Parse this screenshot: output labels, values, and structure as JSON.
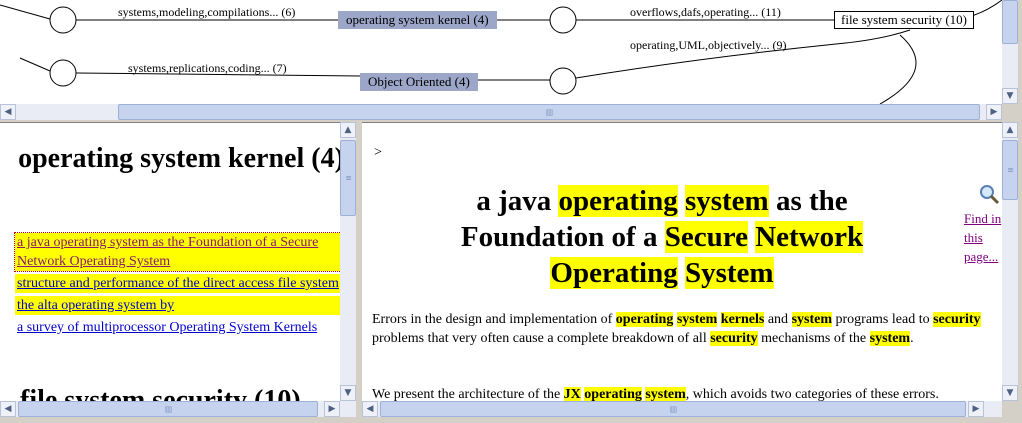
{
  "graph": {
    "edges": [
      {
        "label": "systems,modeling,compilations... (6)"
      },
      {
        "label": "overflows,dafs,operating... (11)"
      },
      {
        "label": "operating,UML,objectively... (9)"
      },
      {
        "label": "systems,replications,coding... (7)"
      }
    ],
    "topics": [
      {
        "label": "operating system kernel (4)"
      },
      {
        "label": "Object Oriented (4)"
      }
    ],
    "selected": {
      "label": "file system security (10)"
    }
  },
  "left": {
    "heading1": "operating system kernel (4)",
    "links": [
      {
        "text": "a java operating system as the Foundation of a Secure Network Operating System",
        "highlight": true
      },
      {
        "text": "structure and performance of the direct access file system",
        "highlight": true
      },
      {
        "text": "the alta operating system by",
        "highlight": true
      },
      {
        "text": "a survey of multiprocessor Operating System Kernels",
        "highlight": false
      }
    ],
    "heading2": "file system security (10)"
  },
  "right": {
    "prompt": ">",
    "title_parts": [
      {
        "t": "a java ",
        "h": false
      },
      {
        "t": "operating",
        "h": true
      },
      {
        "t": " ",
        "h": false
      },
      {
        "t": "system",
        "h": true
      },
      {
        "t": " as the Foundation of a ",
        "h": false
      },
      {
        "t": "Secure",
        "h": true
      },
      {
        "t": " ",
        "h": false
      },
      {
        "t": "Network",
        "h": true
      },
      {
        "t": " ",
        "h": false
      },
      {
        "t": "Operating",
        "h": true
      },
      {
        "t": " ",
        "h": false
      },
      {
        "t": "System",
        "h": true
      }
    ],
    "para1": [
      {
        "t": "Errors in the design and implementation of ",
        "h": false
      },
      {
        "t": "operating",
        "h": true
      },
      {
        "t": " ",
        "h": false
      },
      {
        "t": "system",
        "h": true
      },
      {
        "t": " ",
        "h": false
      },
      {
        "t": "kernels",
        "h": true
      },
      {
        "t": " and ",
        "h": false
      },
      {
        "t": "system",
        "h": true
      },
      {
        "t": " programs lead to ",
        "h": false
      },
      {
        "t": "security",
        "h": true
      },
      {
        "t": " problems that very often cause a complete breakdown of all ",
        "h": false
      },
      {
        "t": "security",
        "h": true
      },
      {
        "t": " mechanisms of the ",
        "h": false
      },
      {
        "t": "system",
        "h": true
      },
      {
        "t": ".",
        "h": false
      }
    ],
    "para2": [
      {
        "t": "We present the architecture of the ",
        "h": false
      },
      {
        "t": "JX",
        "h": true
      },
      {
        "t": " ",
        "h": false
      },
      {
        "t": "operating",
        "h": true
      },
      {
        "t": " ",
        "h": false
      },
      {
        "t": "system",
        "h": true
      },
      {
        "t": ", which avoids two categories of these errors.",
        "h": false
      }
    ],
    "find_link": "Find in this page..."
  }
}
